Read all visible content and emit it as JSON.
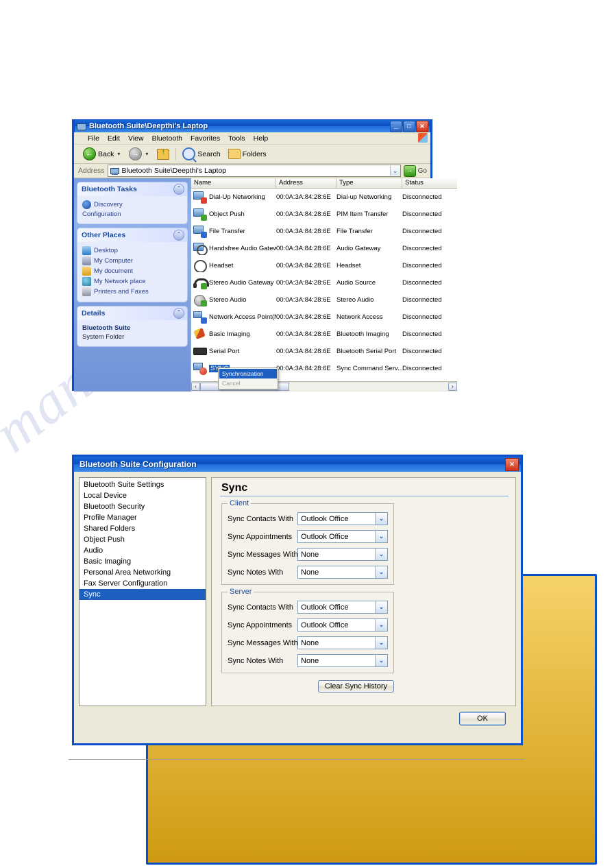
{
  "watermark": {
    "text": "manualshive.com"
  },
  "explorer": {
    "title": "Bluetooth Suite\\Deepthi's Laptop",
    "title_icon": "computer-icon",
    "window_buttons": {
      "minimize": "_",
      "maximize": "□",
      "close": "✕"
    },
    "menu": [
      "File",
      "Edit",
      "View",
      "Bluetooth",
      "Favorites",
      "Tools",
      "Help"
    ],
    "toolbar": {
      "back": "Back",
      "back_caret": "▾",
      "forward_caret": "▾",
      "search": "Search",
      "folders": "Folders"
    },
    "address": {
      "label": "Address",
      "value": "Bluetooth Suite\\Deepthi's Laptop",
      "dropdown_caret": "⌄",
      "go_label": "Go",
      "go_arrow": "→"
    },
    "sidebar": {
      "panels": [
        {
          "title": "Bluetooth Tasks",
          "collapse": "⌃",
          "items": [
            {
              "label": "Discovery",
              "icon": "bluetooth-icon"
            },
            {
              "label": "Configuration",
              "icon": "configuration-icon"
            }
          ]
        },
        {
          "title": "Other Places",
          "collapse": "⌃",
          "items": [
            {
              "label": "Desktop",
              "icon": "desktop-icon"
            },
            {
              "label": "My Computer",
              "icon": "my-computer-icon"
            },
            {
              "label": "My document",
              "icon": "documents-folder-icon"
            },
            {
              "label": "My Network place",
              "icon": "network-icon"
            },
            {
              "label": "Printers and Faxes",
              "icon": "printer-icon"
            }
          ]
        },
        {
          "title": "Details",
          "collapse": "⌃",
          "items": [
            {
              "label": "Bluetooth Suite",
              "icon": ""
            },
            {
              "label": "System Folder",
              "icon": ""
            }
          ]
        }
      ]
    },
    "list": {
      "columns": [
        "Name",
        "Address",
        "Type",
        "Status"
      ],
      "rows": [
        {
          "name": "Dial-Up Networking",
          "address": "00:0A:3A:84:28:6E",
          "type": "Dial-up Networking",
          "status": "Disconnected",
          "icon": "dialup-icon"
        },
        {
          "name": "Object Push",
          "address": "00:0A:3A:84:28:6E",
          "type": "PIM Item Transfer",
          "status": "Disconnected",
          "icon": "object-push-icon"
        },
        {
          "name": "File Transfer",
          "address": "00:0A:3A:84:28:6E",
          "type": "File Transfer",
          "status": "Disconnected",
          "icon": "file-transfer-icon"
        },
        {
          "name": "Handsfree Audio Gateway",
          "address": "00:0A:3A:84:28:6E",
          "type": "Audio Gateway",
          "status": "Disconnected",
          "icon": "handsfree-icon"
        },
        {
          "name": "Headset",
          "address": "00:0A:3A:84:28:6E",
          "type": "Headset",
          "status": "Disconnected",
          "icon": "headset-icon"
        },
        {
          "name": "Stereo Audio Gateway",
          "address": "00:0A:3A:84:28:6E",
          "type": "Audio Source",
          "status": "Disconnected",
          "icon": "stereo-gateway-icon"
        },
        {
          "name": "Stereo Audio",
          "address": "00:0A:3A:84:28:6E",
          "type": "Stereo Audio",
          "status": "Disconnected",
          "icon": "stereo-audio-icon"
        },
        {
          "name": "Network Access Point(N...",
          "address": "00:0A:3A:84:28:6E",
          "type": "Network Access",
          "status": "Disconnected",
          "icon": "network-access-icon"
        },
        {
          "name": "Basic Imaging",
          "address": "00:0A:3A:84:28:6E",
          "type": "Bluetooth Imaging",
          "status": "Disconnected",
          "icon": "basic-imaging-icon"
        },
        {
          "name": "Serial Port",
          "address": "00:0A:3A:84:28:6E",
          "type": "Bluetooth Serial Port",
          "status": "Disconnected",
          "icon": "serial-port-icon"
        },
        {
          "name": "SYNC",
          "address": "00:0A:3A:84:28:6E",
          "type": "Sync Command Serv...",
          "status": "Disconnected",
          "icon": "sync-icon",
          "selected": true
        }
      ],
      "scroll_left": "‹",
      "scroll_right": "›"
    },
    "context_menu": {
      "items": [
        "Synchronization",
        "Cancel"
      ]
    }
  },
  "config_dialog": {
    "title": "Bluetooth Suite Configuration",
    "close": "✕",
    "nav_items": [
      "Bluetooth Suite Settings",
      "Local Device",
      "Bluetooth Security",
      "Profile Manager",
      "Shared Folders",
      "Object Push",
      "Audio",
      "Basic Imaging",
      "Personal Area Networking",
      "Fax Server Configuration",
      "Sync"
    ],
    "selected_nav": "Sync",
    "page_title": "Sync",
    "groups": [
      {
        "legend": "Client",
        "fields": [
          {
            "label": "Sync Contacts With",
            "value": "Outlook Office",
            "caret": "⌄"
          },
          {
            "label": "Sync Appointments",
            "value": "Outlook Office",
            "caret": "⌄"
          },
          {
            "label": "Sync Messages With",
            "value": "None",
            "caret": "⌄"
          },
          {
            "label": "Sync Notes With",
            "value": "None",
            "caret": "⌄"
          }
        ]
      },
      {
        "legend": "Server",
        "fields": [
          {
            "label": "Sync Contacts With",
            "value": "Outlook Office",
            "caret": "⌄"
          },
          {
            "label": "Sync Appointments",
            "value": "Outlook Office",
            "caret": "⌄"
          },
          {
            "label": "Sync Messages With",
            "value": "None",
            "caret": "⌄"
          },
          {
            "label": "Sync Notes With",
            "value": "None",
            "caret": "⌄"
          }
        ]
      }
    ],
    "clear_button": "Clear Sync History",
    "ok_button": "OK"
  },
  "colors": {
    "titlebar_blue": "#0a4cc0",
    "selection_blue": "#1d5fc0",
    "window_face": "#ece9d8",
    "close_red": "#cf3018"
  }
}
